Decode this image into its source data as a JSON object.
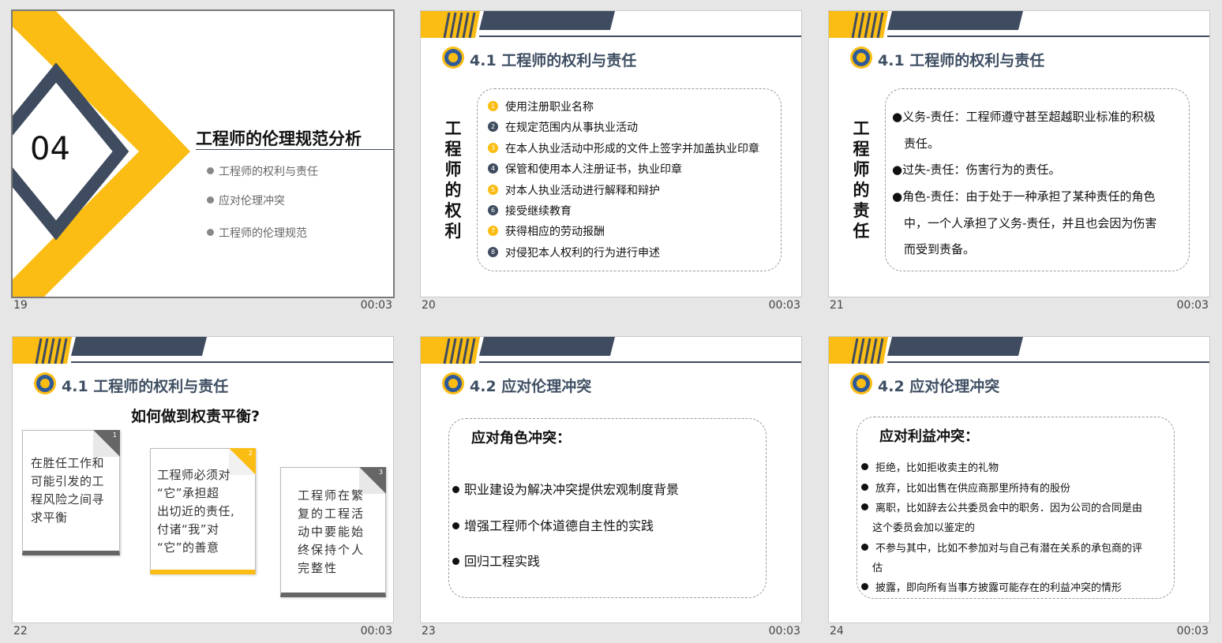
{
  "colors": {
    "accent": "#fbbd13",
    "navy": "#3f4b5f"
  },
  "slides": [
    {
      "number": "19",
      "time": "00:03",
      "big_number": "04",
      "title": "工程师的伦理规范分析",
      "outline": [
        "工程师的权利与责任",
        "应对伦理冲突",
        "工程师的伦理规范"
      ]
    },
    {
      "number": "20",
      "time": "00:03",
      "header": "4.1 工程师的权利与责任",
      "side_title": [
        "工",
        "程",
        "师",
        "的",
        "权",
        "利"
      ],
      "items": [
        "使用注册职业名称",
        "在规定范围内从事执业活动",
        "在本人执业活动中形成的文件上签字并加盖执业印章",
        "保管和使用本人注册证书，执业印章",
        "对本人执业活动进行解释和辩护",
        "接受继续教育",
        "获得相应的劳动报酬",
        "对侵犯本人权利的行为进行申述"
      ],
      "item_markers": [
        "1",
        "2",
        "3",
        "4",
        "5",
        "6",
        "7",
        "8"
      ]
    },
    {
      "number": "21",
      "time": "00:03",
      "header": "4.1 工程师的权利与责任",
      "side_title": [
        "工",
        "程",
        "师",
        "的",
        "责",
        "任"
      ],
      "lines": [
        "●义务-责任：工程师遵守甚至超越职业标准的积极",
        "责任。",
        "●过失-责任：伤害行为的责任。",
        "●角色-责任：由于处于一种承担了某种责任的角色",
        "中，一个人承担了义务-责任，并且也会因为伤害",
        "而受到责备。"
      ]
    },
    {
      "number": "22",
      "time": "00:03",
      "header": "4.1 工程师的权利与责任",
      "question": "如何做到权责平衡?",
      "cards": [
        {
          "tag": "1",
          "lines": [
            "在胜任工作和",
            "可能引发的工",
            "程风险之间寻",
            "求平衡"
          ]
        },
        {
          "tag": "2",
          "lines": [
            "工程师必须对",
            "“它”承担超",
            "出切近的责任,",
            "付诸“我”对",
            "“它”的善意"
          ]
        },
        {
          "tag": "3",
          "lines": [
            "工程师在繁",
            "复的工程活",
            "动中要能始",
            "终保持个人",
            "完整性"
          ]
        }
      ]
    },
    {
      "number": "23",
      "time": "00:03",
      "header": "4.2 应对伦理冲突",
      "box_title": "应对角色冲突：",
      "items": [
        "职业建设为解决冲突提供宏观制度背景",
        "增强工程师个体道德自主性的实践",
        "回归工程实践"
      ]
    },
    {
      "number": "24",
      "time": "00:03",
      "header": "4.2 应对伦理冲突",
      "box_title": "应对利益冲突：",
      "items": [
        "拒绝，比如拒收卖主的礼物",
        "放弃，比如出售在供应商那里所持有的股份",
        "离职，比如辞去公共委员会中的职务．因为公司的合同是由",
        "这个委员会加以鉴定的",
        "不参与其中，比如不参加对与自己有潜在关系的承包商的评",
        "估",
        "披露，即向所有当事方披露可能存在的利益冲突的情形"
      ]
    }
  ]
}
